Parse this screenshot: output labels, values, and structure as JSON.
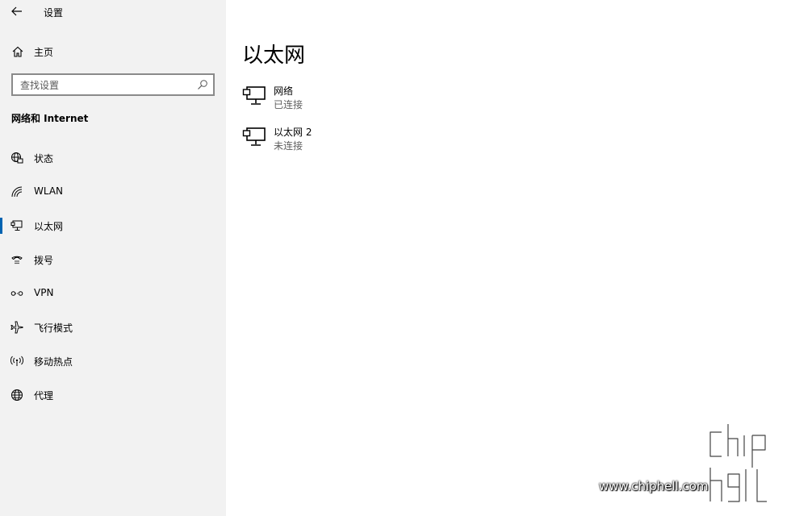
{
  "window": {
    "title": "设置"
  },
  "sidebar": {
    "home_label": "主页",
    "search_placeholder": "查找设置",
    "section_title": "网络和 Internet",
    "items": [
      {
        "label": "状态",
        "icon": "status-globe-icon"
      },
      {
        "label": "WLAN",
        "icon": "wifi-icon"
      },
      {
        "label": "以太网",
        "icon": "ethernet-icon",
        "selected": true
      },
      {
        "label": "拨号",
        "icon": "dialup-icon"
      },
      {
        "label": "VPN",
        "icon": "vpn-icon"
      },
      {
        "label": "飞行模式",
        "icon": "airplane-icon"
      },
      {
        "label": "移动热点",
        "icon": "hotspot-icon"
      },
      {
        "label": "代理",
        "icon": "globe-icon"
      }
    ]
  },
  "main": {
    "title": "以太网",
    "adapters": [
      {
        "name": "网络",
        "status": "已连接"
      },
      {
        "name": "以太网 2",
        "status": "未连接"
      }
    ]
  },
  "watermark": {
    "url": "www.chiphell.com",
    "logo_text": "chip hell"
  },
  "colors": {
    "sidebar_bg": "#f2f2f2",
    "accent": "#0063b1",
    "main_bg": "#ffffff"
  }
}
